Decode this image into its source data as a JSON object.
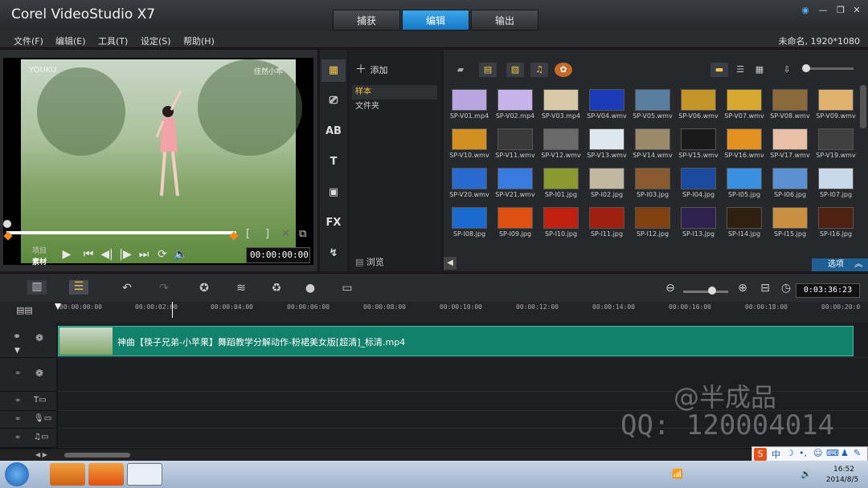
{
  "window": {
    "title": "Corel VideoStudio X7",
    "mode_tabs": [
      "捕获",
      "编辑",
      "输出"
    ],
    "active_tab": "编辑",
    "project_info": "未命名, 1920*1080"
  },
  "menu": [
    "文件(F)",
    "编辑(E)",
    "工具(T)",
    "设定(S)",
    "帮助(H)"
  ],
  "preview": {
    "watermark": "YOUKU",
    "watermark_right": "佳然小乖",
    "mode_labels": [
      "项目",
      "素材"
    ],
    "timecode": "00:00:00:00",
    "controls": [
      "play-icon",
      "home-icon",
      "prev-frame-icon",
      "next-frame-icon",
      "end-icon",
      "repeat-icon",
      "volume-icon"
    ]
  },
  "library": {
    "add_label": "添加",
    "folders": [
      "样本",
      "文件夹"
    ],
    "selected_folder": "样本",
    "browse_label": "浏览",
    "options_label": "选项",
    "thumbnails": [
      [
        "SP-V01.mp4",
        "SP-V02.mp4",
        "SP-V03.mp4",
        "SP-V04.wmv",
        "SP-V05.wmv",
        "SP-V06.wmv",
        "SP-V07.wmv",
        "SP-V08.wmv",
        "SP-V09.wmv"
      ],
      [
        "SP-V10.wmv",
        "SP-V11.wmv",
        "SP-V12.wmv",
        "SP-V13.wmv",
        "SP-V14.wmv",
        "SP-V15.wmv",
        "SP-V16.wmv",
        "SP-V17.wmv",
        "SP-V19.wmv"
      ],
      [
        "SP-V20.wmv",
        "SP-V21.wmv",
        "SP-I01.jpg",
        "SP-I02.jpg",
        "SP-I03.jpg",
        "SP-I04.jpg",
        "SP-I05.jpg",
        "SP-I06.jpg",
        "SP-I07.jpg"
      ],
      [
        "SP-I08.jpg",
        "SP-I09.jpg",
        "SP-I10.jpg",
        "SP-I11.jpg",
        "SP-I12.jpg",
        "SP-I13.jpg",
        "SP-I14.jpg",
        "SP-I15.jpg",
        "SP-I16.jpg"
      ]
    ],
    "thumb_colors": [
      [
        "#b9a6e0",
        "#c6b3ea",
        "#d8c8a8",
        "#1c3bb8",
        "#5a7ea0",
        "#c2942a",
        "#d8a830",
        "#8a6a3a",
        "#e0b070"
      ],
      [
        "#d39022",
        "#3a3a3a",
        "#6a6a6a",
        "#dfe7ee",
        "#9a8a6a",
        "#1a1a1a",
        "#e49020",
        "#e8c0a8",
        "#404040"
      ],
      [
        "#2a6ad0",
        "#3a7ae0",
        "#8a9a30",
        "#c0b8a0",
        "#8a5a30",
        "#1a4aa0",
        "#3a90e0",
        "#5a90d0",
        "#c8d8e8"
      ],
      [
        "#1a6ad0",
        "#e05010",
        "#c02010",
        "#a02010",
        "#804010",
        "#302050",
        "#302010",
        "#c89040",
        "#502010"
      ]
    ]
  },
  "timeline": {
    "duration": "0:03:36:23",
    "ruler": [
      "00:00:00:00",
      "00:00:02:00",
      "00:00:04:00",
      "00:00:06:00",
      "00:00:08:00",
      "00:00:10:00",
      "00:00:12:00",
      "00:00:14:00",
      "00:00:16:00",
      "00:00:18:00",
      "00:00:20:0"
    ],
    "clip_name": "神曲【筷子兄弟-小苹果】舞蹈教学分解动作-粉裙美女版[超清]_标清.mp4"
  },
  "overlay": {
    "watermark_name": "@半成品",
    "watermark_qq": "QQ: 120004014"
  },
  "taskbar": {
    "time": "16:52",
    "date": "2014/8/5",
    "ime_char": "中"
  }
}
